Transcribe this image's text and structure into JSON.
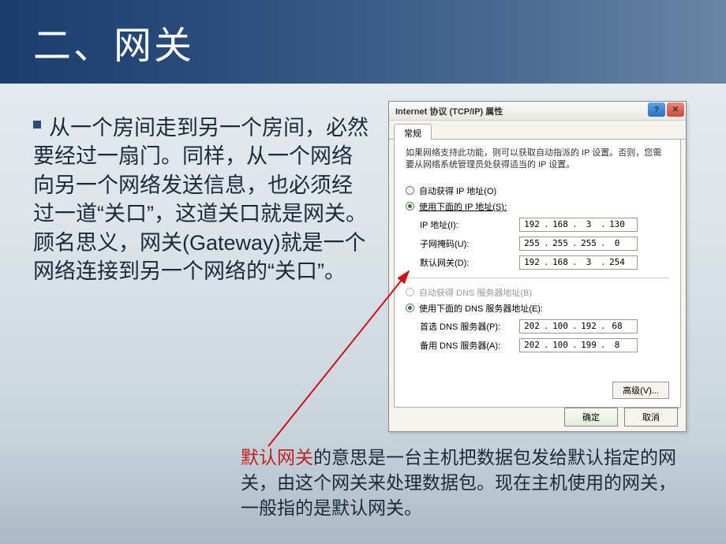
{
  "slide": {
    "title": "二、网关",
    "bullet": "从一个房间走到另一个房间，必然要经过一扇门。同样，从一个网络向另一个网络发送信息，也必须经过一道“关口”，这道关口就是网关。顾名思义，网关(Gateway)就是一个网络连接到另一个网络的“关口”。"
  },
  "dialog": {
    "title": "Internet 协议 (TCP/IP) 属性",
    "help_glyph": "?",
    "close_glyph": "✕",
    "tab": "常规",
    "intro": "如果网络支持此功能，则可以获取自动指派的 IP 设置。否则，您需要从网络系统管理员处获得适当的 IP 设置。",
    "ip_section": {
      "auto_label": "自动获得 IP 地址(O)",
      "manual_label": "使用下面的 IP 地址(S):",
      "fields": {
        "ip_label": "IP 地址(I):",
        "ip_value": [
          "192",
          "168",
          "3",
          "130"
        ],
        "mask_label": "子网掩码(U):",
        "mask_value": [
          "255",
          "255",
          "255",
          "0"
        ],
        "gw_label": "默认网关(D):",
        "gw_value": [
          "192",
          "168",
          "3",
          "254"
        ]
      }
    },
    "dns_section": {
      "auto_label": "自动获得 DNS 服务器地址(B)",
      "manual_label": "使用下面的 DNS 服务器地址(E):",
      "fields": {
        "primary_label": "首选 DNS 服务器(P):",
        "primary_value": [
          "202",
          "100",
          "192",
          "68"
        ],
        "alt_label": "备用 DNS 服务器(A):",
        "alt_value": [
          "202",
          "100",
          "199",
          "8"
        ]
      }
    },
    "advanced_button": "高级(V)...",
    "ok_button": "确定",
    "cancel_button": "取消"
  },
  "footnote": {
    "highlight": "默认网关",
    "rest": "的意思是一台主机把数据包发给默认指定的网关，由这个网关来处理数据包。现在主机使用的网关，一般指的是默认网关。"
  }
}
